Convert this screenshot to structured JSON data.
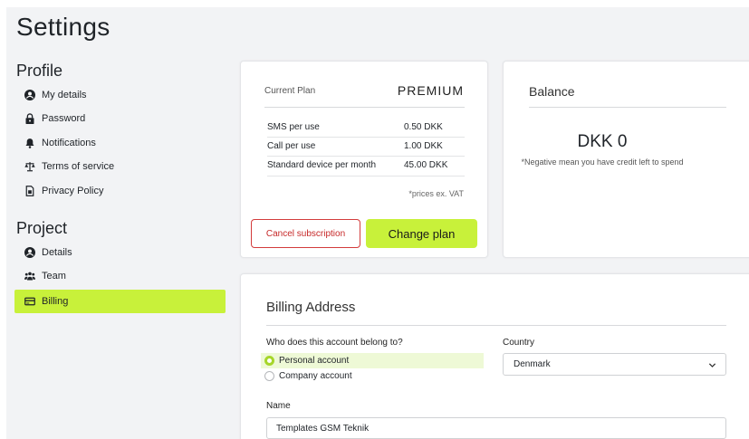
{
  "page": {
    "title": "Settings"
  },
  "sidebar": {
    "profile_heading": "Profile",
    "profile_items": [
      {
        "label": "My details",
        "icon": "user-circle-icon"
      },
      {
        "label": "Password",
        "icon": "lock-icon"
      },
      {
        "label": "Notifications",
        "icon": "bell-icon"
      },
      {
        "label": "Terms of service",
        "icon": "scale-icon"
      },
      {
        "label": "Privacy Policy",
        "icon": "document-icon"
      }
    ],
    "project_heading": "Project",
    "project_items": [
      {
        "label": "Details",
        "icon": "user-circle-icon"
      },
      {
        "label": "Team",
        "icon": "team-icon"
      },
      {
        "label": "Billing",
        "icon": "credit-card-icon",
        "active": true
      }
    ]
  },
  "plan_card": {
    "current_plan_label": "Current Plan",
    "plan_name": "PREMIUM",
    "prices": [
      {
        "label": "SMS per use",
        "value": "0.50 DKK"
      },
      {
        "label": "Call per use",
        "value": "1.00 DKK"
      },
      {
        "label": "Standard device per month",
        "value": "45.00 DKK"
      }
    ],
    "vat_note": "*prices ex. VAT",
    "cancel_label": "Cancel subscription",
    "change_label": "Change plan"
  },
  "balance_card": {
    "title": "Balance",
    "amount": "DKK 0",
    "note": "*Negative mean you have credit left to spend"
  },
  "billing_address": {
    "title": "Billing Address",
    "belong_label": "Who does this account belong to?",
    "options": [
      {
        "label": "Personal account",
        "selected": true
      },
      {
        "label": "Company account",
        "selected": false
      }
    ],
    "country_label": "Country",
    "country_value": "Denmark",
    "name_label": "Name",
    "name_value": "Templates GSM Teknik"
  },
  "colors": {
    "accent": "#c8f13a",
    "danger": "#c62828",
    "background": "#f2f3f5"
  }
}
